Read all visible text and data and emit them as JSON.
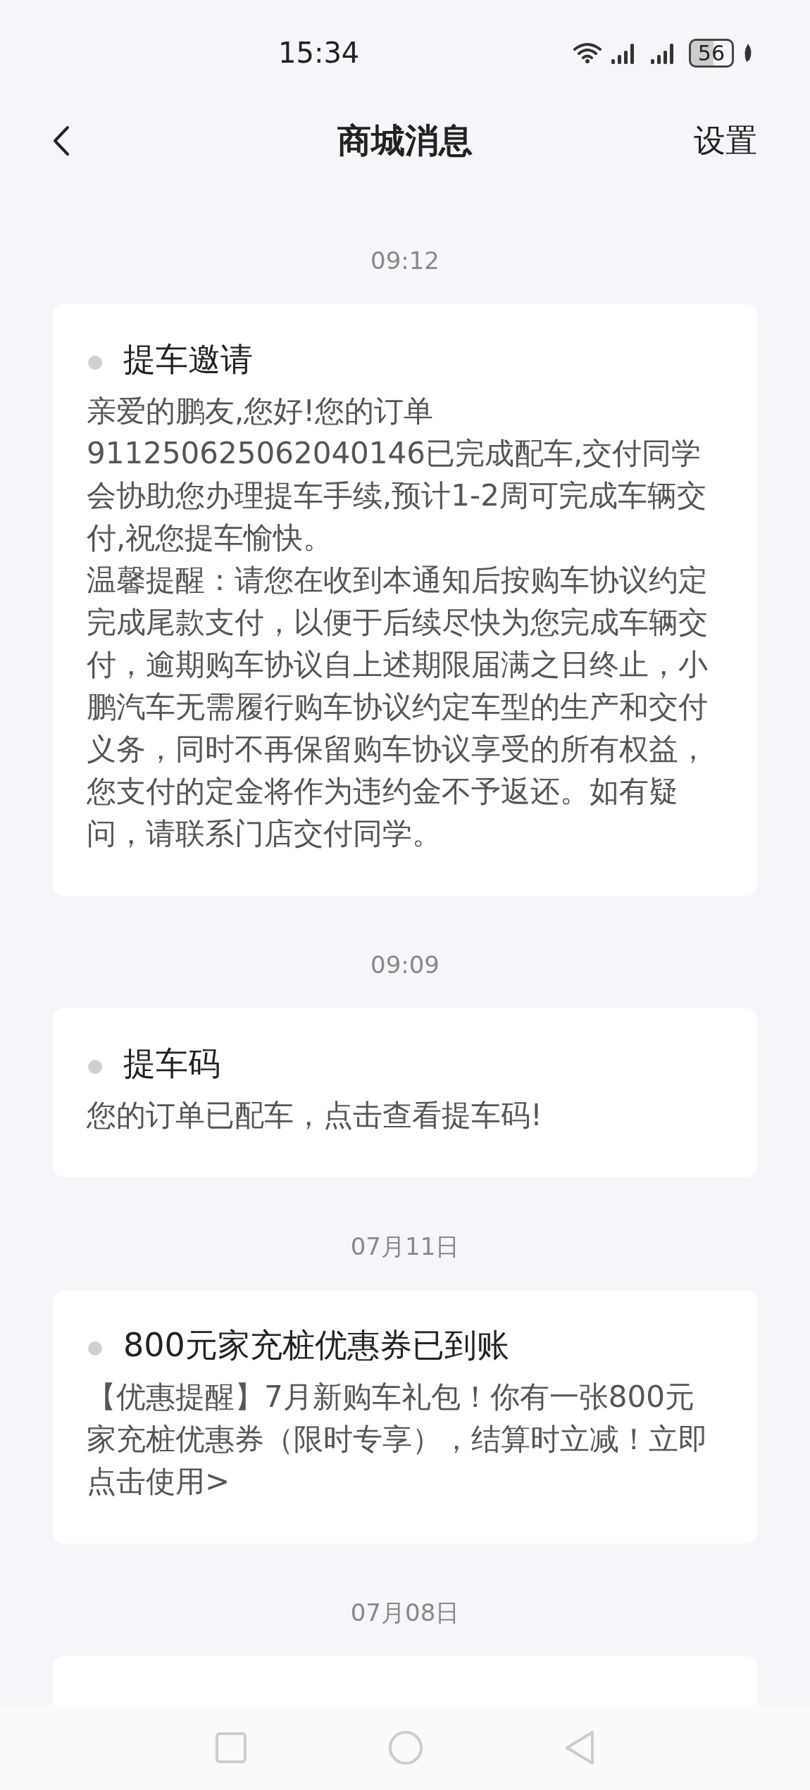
{
  "status_bar": {
    "time": "15:34",
    "battery": "56"
  },
  "header": {
    "title": "商城消息",
    "action": "设置"
  },
  "messages": [
    {
      "time": "09:12",
      "title": "提车邀请",
      "read": true,
      "body": [
        "亲爱的鹏友,您好!您的订单911250625062040146已完成配车,交付同学会协助您办理提车手续,预计1-2周可完成车辆交付,祝您提车愉快。",
        "温馨提醒：请您在收到本通知后按购车协议约定完成尾款支付，以便于后续尽快为您完成车辆交付，逾期购车协议自上述期限届满之日终止，小鹏汽车无需履行购车协议约定车型的生产和交付义务，同时不再保留购车协议享受的所有权益，您支付的定金将作为违约金不予返还。如有疑问，请联系门店交付同学。"
      ]
    },
    {
      "time": "09:09",
      "title": "提车码",
      "read": true,
      "body": [
        "您的订单已配车，点击查看提车码!"
      ]
    },
    {
      "time": "07月11日",
      "title": "800元家充桩优惠券已到账",
      "read": true,
      "body": [
        "【优惠提醒】7月新购车礼包！你有一张800元家充桩优惠券（限时专享），结算时立减！立即点击使用>"
      ]
    },
    {
      "time": "07月08日"
    }
  ]
}
